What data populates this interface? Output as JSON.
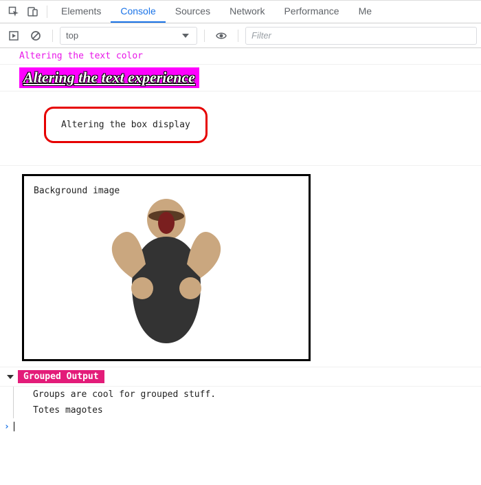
{
  "tabbar": {
    "tabs": [
      {
        "label": "Elements",
        "active": false
      },
      {
        "label": "Console",
        "active": true
      },
      {
        "label": "Sources",
        "active": false
      },
      {
        "label": "Network",
        "active": false
      },
      {
        "label": "Performance",
        "active": false
      },
      {
        "label": "Me",
        "active": false
      }
    ]
  },
  "toolbar": {
    "context_label": "top",
    "filter_placeholder": "Filter"
  },
  "console_messages": {
    "line1_text": "Altering the text color",
    "line2_text": "Altering the text experience",
    "line3_text": "Altering the box display",
    "line4_caption": "Background image"
  },
  "group": {
    "label": "Grouped Output",
    "lines": {
      "l0": "Groups are cool for grouped stuff.",
      "l1": "Totes magotes"
    }
  },
  "icons": {
    "inspect": "inspect-icon",
    "device": "device-toggle-icon",
    "stepover": "step-icon",
    "clear": "clear-icon",
    "eye": "eye-icon",
    "chevron": "chevron-down-icon"
  }
}
